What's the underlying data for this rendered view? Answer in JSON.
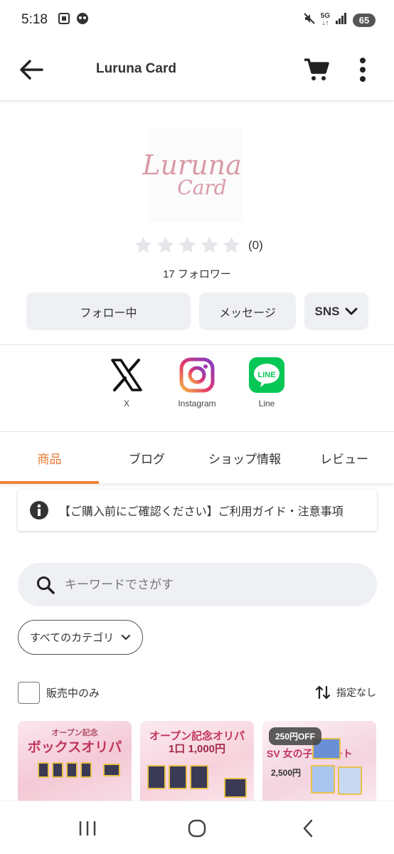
{
  "status_bar": {
    "time": "5:18",
    "network": "5G",
    "battery": "65"
  },
  "app_bar": {
    "title": "Luruna Card",
    "back_icon": "arrow-left-icon",
    "cart_icon": "cart-icon",
    "more_icon": "more-vertical-icon"
  },
  "shop": {
    "logo_line1": "Luruna",
    "logo_line2": "Card",
    "rating_count": "(0)",
    "followers": "17 フォロワー",
    "follow_label": "フォロー中",
    "message_label": "メッセージ",
    "sns_label": "SNS"
  },
  "sns_links": [
    {
      "label": "X",
      "icon": "x-logo-icon"
    },
    {
      "label": "Instagram",
      "icon": "instagram-icon"
    },
    {
      "label": "Line",
      "icon": "line-icon"
    }
  ],
  "tabs": [
    {
      "label": "商品",
      "active": true
    },
    {
      "label": "ブログ",
      "active": false
    },
    {
      "label": "ショップ情報",
      "active": false
    },
    {
      "label": "レビュー",
      "active": false
    }
  ],
  "notice": {
    "text": "【ご購入前にご確認ください】ご利用ガイド・注意事項"
  },
  "search": {
    "placeholder": "キーワードでさがす"
  },
  "filters": {
    "category_label": "すべてのカテゴリ",
    "on_sale_label": "販売中のみ",
    "sort_label": "指定なし"
  },
  "products": [
    {
      "title": "ボックスオリパ",
      "subtitle": "オープン記念"
    },
    {
      "title": "オープン記念オリパ",
      "subtitle": "1口 1,000円"
    },
    {
      "title": "SV 女の子サポート",
      "subtitle": "2,500円",
      "badge": "250円OFF"
    }
  ],
  "colors": {
    "accent": "#f28536",
    "button_bg": "#eef0f4",
    "star": "#e4e6ea"
  }
}
